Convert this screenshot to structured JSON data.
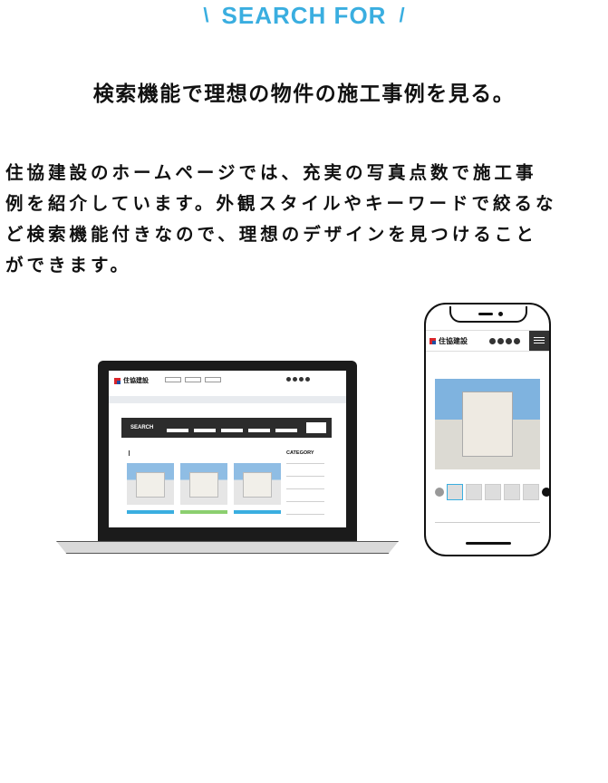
{
  "heading": {
    "left_mark": "\\",
    "title": "SEARCH FOR",
    "right_mark": "/"
  },
  "lead": "検索機能で理想の物件の施工事例を見る。",
  "body": [
    "住協建設のホームページでは、充実の写真点数で施工事",
    "例を紹介しています。外観スタイルやキーワードで絞るな",
    "ど検索機能付きなので、理想のデザインを見つけること",
    "ができます。"
  ],
  "laptop": {
    "brand": "住協建設",
    "search_label": "SEARCH",
    "category_label": "CATEGORY"
  },
  "phone": {
    "brand": "住協建設"
  },
  "colors": {
    "accent": "#3aaee0",
    "text": "#111111",
    "device": "#1b1b1b"
  }
}
